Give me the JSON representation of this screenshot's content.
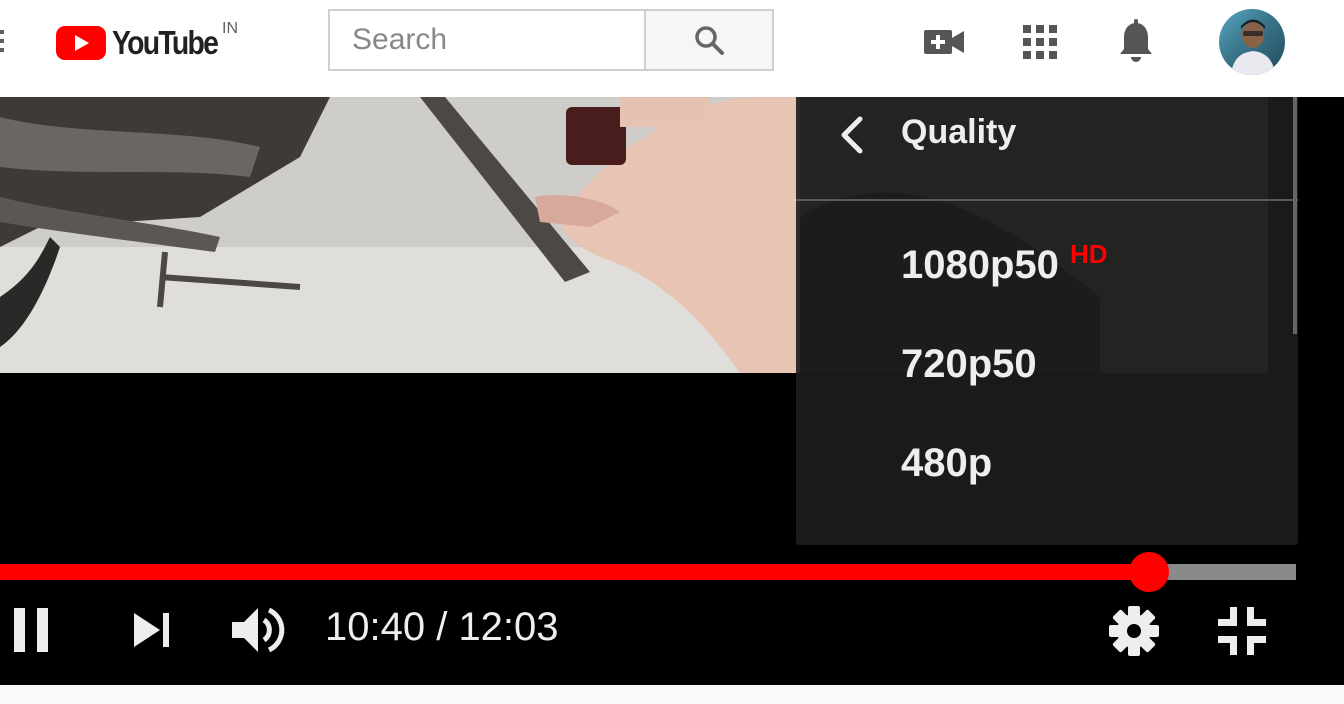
{
  "header": {
    "logo_text": "YouTube",
    "country_code": "IN",
    "search": {
      "placeholder": "Search",
      "value": ""
    },
    "icons": [
      "menu-icon",
      "search-icon",
      "create-video-icon",
      "apps-grid-icon",
      "notifications-bell-icon"
    ],
    "avatar_label": "User avatar"
  },
  "player": {
    "quality_menu": {
      "title": "Quality",
      "options": [
        {
          "label": "1080p50",
          "badge": "HD"
        },
        {
          "label": "720p50",
          "badge": ""
        },
        {
          "label": "480p",
          "badge": ""
        }
      ]
    },
    "progress": {
      "fraction": 0.8864,
      "current": "10:40",
      "duration": "12:03"
    },
    "time_text": "10:40 / 12:03"
  },
  "colors": {
    "accent": "#ff0000",
    "menu_bg": "#1c1c1c",
    "player_bg": "#000000"
  }
}
